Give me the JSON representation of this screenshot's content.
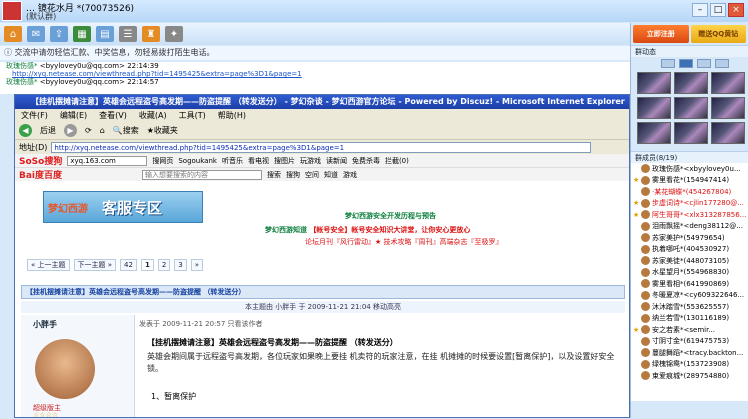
{
  "window": {
    "title": "… 镜花水月 *(70073526)",
    "subtitle": "(默认群)"
  },
  "notice": "交流中请勿轻信汇款、中奖信息，勿轻易拨打陌生电话。",
  "chat": [
    {
      "name": "玫瑰伤感*",
      "email": "<byylovey0u@qq.com>",
      "time": "22:14:39",
      "link": "http://xyq.netease.com/viewthread.php?tid=1495425&extra=page%3D1&page=1"
    },
    {
      "name": "玫瑰伤感*",
      "email": "<byylovey0u@qq.com>",
      "time": "22:14:57"
    }
  ],
  "browser": {
    "title": "【挂机摆摊请注意】英雄会远程盗号高发期——防盗提醒 （转发送分） - 梦幻杂谈 - 梦幻西游官方论坛 - Powered by Discuz! - Microsoft Internet Explorer",
    "menu": [
      "文件(F)",
      "编辑(E)",
      "查看(V)",
      "收藏(A)",
      "工具(T)",
      "帮助(H)"
    ],
    "nav": {
      "back": "后退",
      "search": "搜索",
      "favorites": "收藏夹"
    },
    "address_label": "地址(D)",
    "url": "http://xyq.netease.com/viewthread.php?tid=1495425&extra=page%3D1&page=1",
    "soso": {
      "logo": "SoSo搜狗",
      "query": "xyq.163.com",
      "items": [
        "搜网页",
        "Sogoukank",
        "听音乐",
        "看电视",
        "搜图片",
        "玩游戏",
        "读新闻",
        "免费杀毒",
        "拦截(0)"
      ]
    },
    "baidu": {
      "logo": "Bai度百度",
      "placeholder": "输入想要搜索的内容",
      "items": [
        "搜索",
        "搜狗",
        "空间",
        "知道",
        "游戏"
      ]
    }
  },
  "page": {
    "logo_game": "梦幻西游",
    "logo_text": "客服专区",
    "ad1": "梦幻西游安全开发历程与预告",
    "ad2_a": "梦幻西游知道",
    "ad2_b": "【帐号安全】帐号安全知识大讲堂，让你安心更放心",
    "ad3": "论坛月刊『风行雷动』★ 技术攻略『周刊』高端杂志『至极罗』",
    "pager": [
      "« 上一主题",
      "下一主题 »",
      "42",
      "1",
      "2",
      "3",
      "»"
    ],
    "thread_title": "【挂机摆摊请注意】英雄会远程盗号高发期——防盗提醒 （转发送分）",
    "meta": "本主题由 小胖手 于 2009-11-21 21:04 移动高亮",
    "post": {
      "user": "小胖手",
      "rank": "超级版主",
      "stars": "☆☆☆☆",
      "time": "发表于 2009-11-21 20:57  只看该作者",
      "title": "【挂机摆摊请注意】英雄会远程盗号高发期——防盗提醒 （转发送分）",
      "text": "英雄会期间属于远程盗号高发期，各位玩家如果晚上要挂 机卖符的玩家注意，在挂 机摊摊的时候要设置[暂离保护]，以及设置好安全锁。",
      "list1": "1、暂离保护"
    }
  },
  "side": {
    "btn1": "立即注册",
    "btn2": "赠送QQ黄钻",
    "album": "群动态",
    "members_head": "群成员(8/19)",
    "members": [
      {
        "name": "玫瑰伤感*<xbyylovey0u...",
        "red": false
      },
      {
        "name": "雾里看花*(154947414)",
        "red": false
      },
      {
        "name": "·某花蝴蝶*(454267804)",
        "red": true
      },
      {
        "name": "步虚词诗*<cjlin177280@...",
        "red": true
      },
      {
        "name": "阿生哥哥*<xlx313287856...",
        "red": true
      },
      {
        "name": "泪雨飘摇*<deng38112@...",
        "red": false
      },
      {
        "name": "苏家美护*(54979654)",
        "red": false
      },
      {
        "name": "执着哪吒*(404530927)",
        "red": false
      },
      {
        "name": "苏家美徒*(448073105)",
        "red": false
      },
      {
        "name": "水星望月*(554968830)",
        "red": false
      },
      {
        "name": "雾里看相*(641990869)",
        "red": false
      },
      {
        "name": "冬暖夏凉*<cy609322646...",
        "red": false
      },
      {
        "name": "沐沐踏雪*(553625557)",
        "red": false
      },
      {
        "name": "纳兰若雪*(130116189)",
        "red": false
      },
      {
        "name": "安之若素*<semir...",
        "red": false
      },
      {
        "name": "寸阴寸金*(619475753)",
        "red": false
      },
      {
        "name": "蔓腿舞蹈*<tracy.backton...",
        "red": false
      },
      {
        "name": "绿槐锦鸯*(153723908)",
        "red": false
      },
      {
        "name": "束爱痕城*(289754880)",
        "red": false
      }
    ]
  }
}
